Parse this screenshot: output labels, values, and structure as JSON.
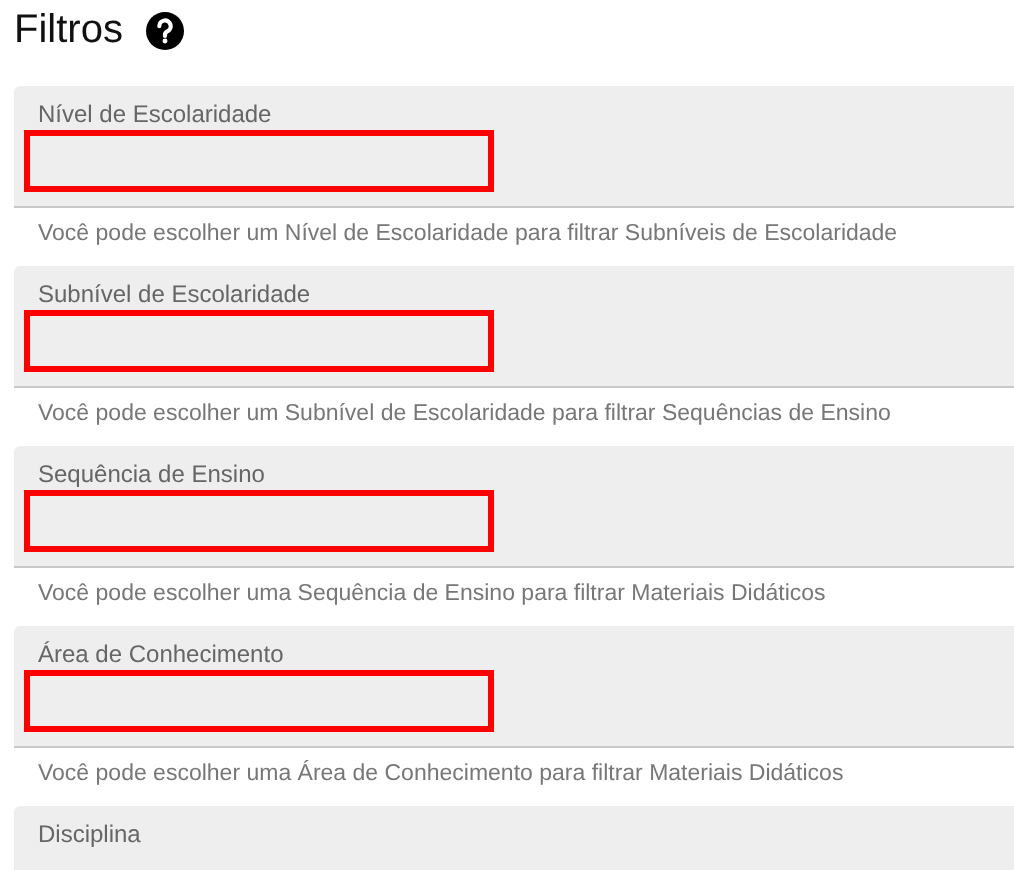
{
  "title": "Filtros",
  "fields": [
    {
      "label": "Nível de Escolaridade",
      "hint": "Você pode escolher um Nível de Escolaridade para filtrar Subníveis de Escolaridade",
      "highlighted": true
    },
    {
      "label": "Subnível de Escolaridade",
      "hint": "Você pode escolher um Subnível de Escolaridade para filtrar Sequências de Ensino",
      "highlighted": true
    },
    {
      "label": "Sequência de Ensino",
      "hint": "Você pode escolher uma Sequência de Ensino para filtrar Materiais Didáticos",
      "highlighted": true
    },
    {
      "label": "Área de Conhecimento",
      "hint": "Você pode escolher uma Área de Conhecimento para filtrar Materiais Didáticos",
      "highlighted": true
    },
    {
      "label": "Disciplina",
      "highlighted": false
    }
  ]
}
